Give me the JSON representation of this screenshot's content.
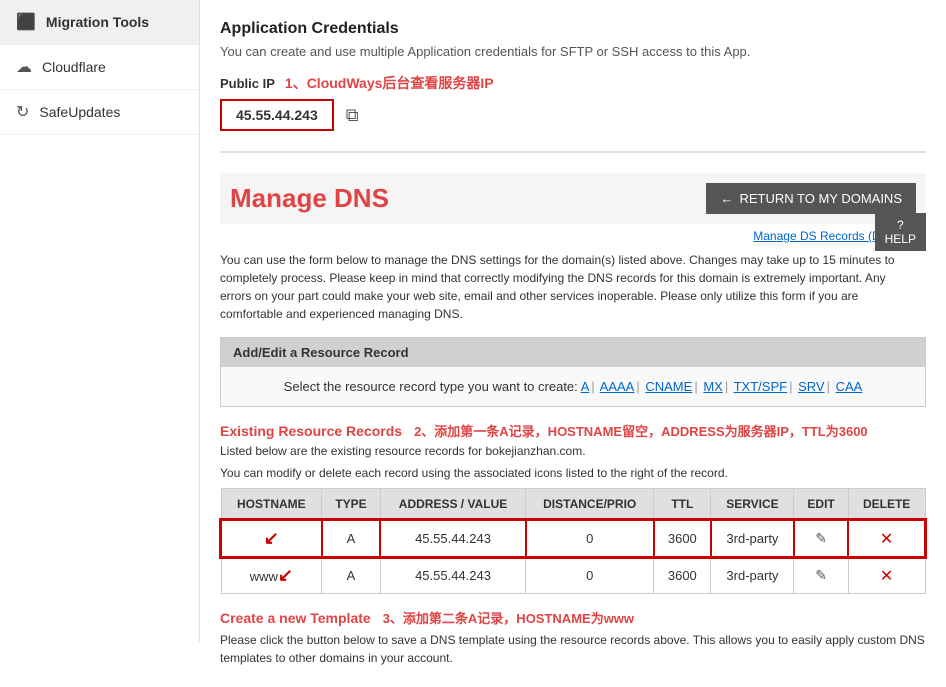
{
  "sidebar": {
    "items": [
      {
        "id": "migration-tools",
        "label": "Migration Tools",
        "icon": "⬛",
        "active": true
      },
      {
        "id": "cloudflare",
        "label": "Cloudflare",
        "icon": "☁"
      },
      {
        "id": "safeupdates",
        "label": "SafeUpdates",
        "icon": "↻"
      }
    ]
  },
  "credentials": {
    "title": "Application Credentials",
    "description": "You can create and use multiple Application credentials for SFTP or SSH access to this App.",
    "public_ip_label": "Public IP",
    "cloudways_note": "1、CloudWays后台查看服务器IP",
    "ip_value": "45.55.44.243"
  },
  "manage_dns": {
    "title": "Manage DNS",
    "return_btn": "RETURN TO MY DOMAINS",
    "manage_ds_link": "Manage DS Records (DNSSEC)",
    "description": "You can use the form below to manage the DNS settings for the domain(s) listed above. Changes may take up to 15 minutes to completely process. Please keep in mind that correctly modifying the DNS records for this domain is extremely important. Any errors on your part could make your web site, email and other services inoperable. Please only utilize this form if you are comfortable and experienced managing DNS.",
    "help_label": "HELP",
    "add_edit_header": "Add/Edit a Resource Record",
    "select_record_text": "Select the resource record type you want to create:",
    "record_types": [
      "A",
      "AAAA",
      "CNAME",
      "MX",
      "TXT/SPF",
      "SRV",
      "CAA"
    ],
    "existing_records_title": "Existing Resource Records",
    "annotation_1": "2、添加第一条A记录，HOSTNAME留空，ADDRESS为服务器IP，TTL为3600",
    "existing_sub_1": "Listed below are the existing resource records for bokejianzhan.com.",
    "existing_sub_2": "You can modify or delete each record using the associated icons listed to the right of the record.",
    "table": {
      "headers": [
        "HOSTNAME",
        "TYPE",
        "ADDRESS / VALUE",
        "DISTANCE/PRIO",
        "TTL",
        "SERVICE",
        "EDIT",
        "DELETE"
      ],
      "rows": [
        {
          "hostname": "",
          "type": "A",
          "address": "45.55.44.243",
          "distance": "0",
          "ttl": "3600",
          "service": "3rd-party",
          "highlighted": true
        },
        {
          "hostname": "www",
          "type": "A",
          "address": "45.55.44.243",
          "distance": "0",
          "ttl": "3600",
          "service": "3rd-party",
          "highlighted": false
        }
      ]
    },
    "create_template_title": "Create a new Template",
    "annotation_3": "3、添加第二条A记录，HOSTNAME为www",
    "create_template_sub": "Please click the button below to save a DNS template using the resource records above. This allows you to easily apply custom DNS templates to other domains in your account."
  }
}
